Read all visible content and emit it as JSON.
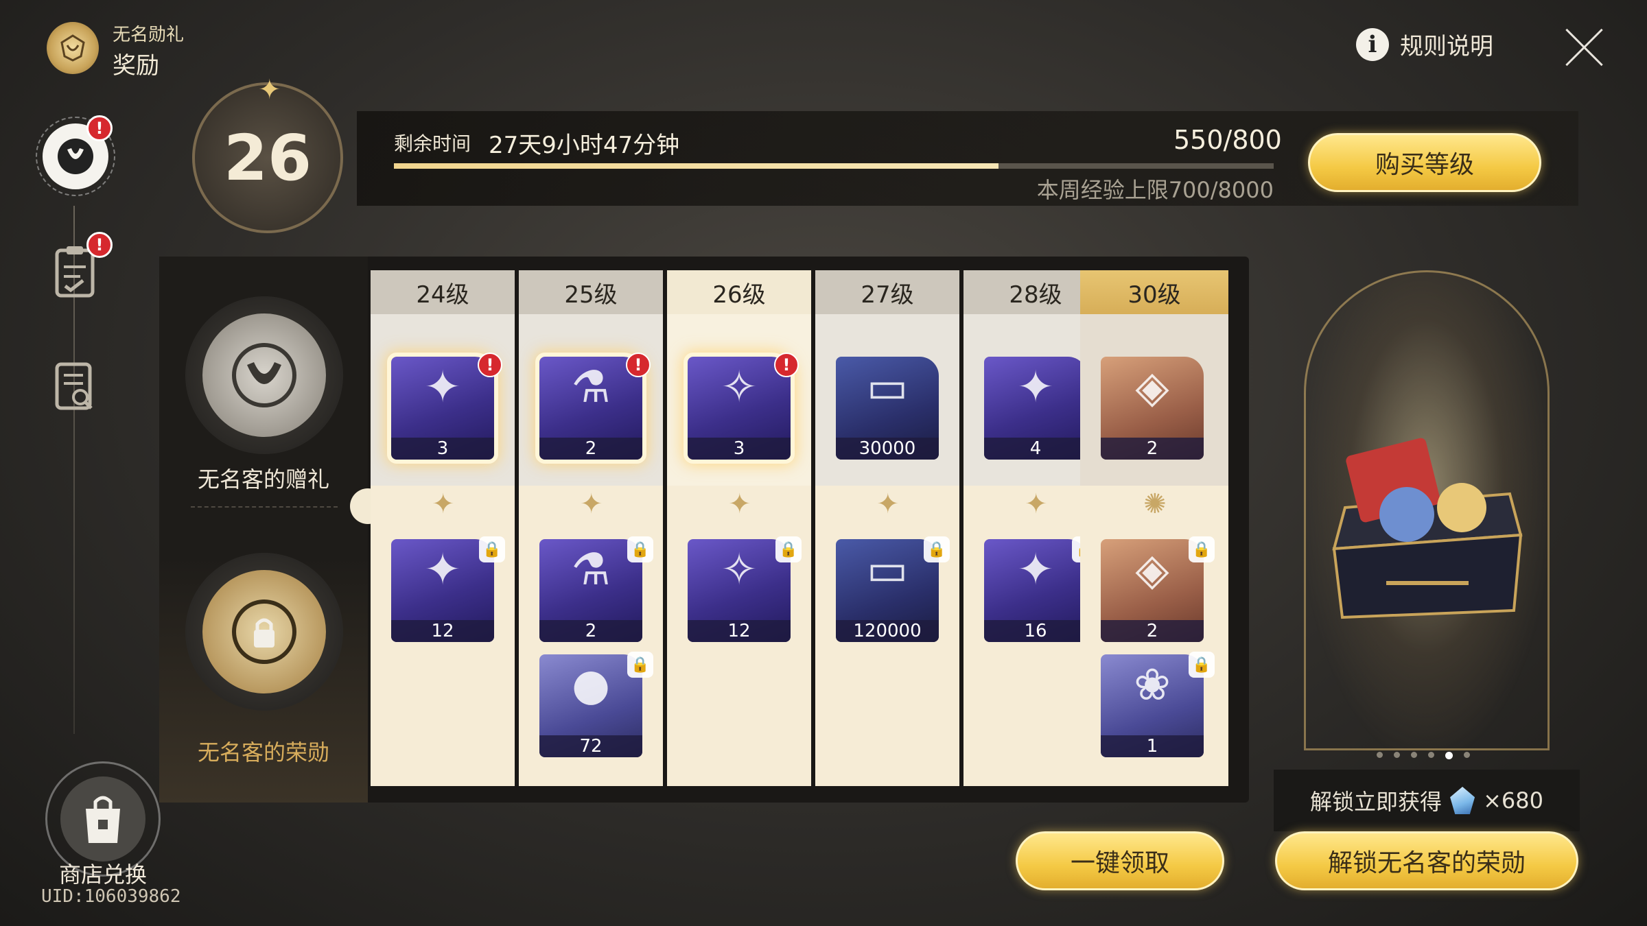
{
  "header": {
    "subtitle": "无名勋礼",
    "title": "奖励",
    "rules_label": "规则说明",
    "rules_icon": "info-icon",
    "close_icon": "close-icon"
  },
  "nav": {
    "alert_glyph": "!",
    "items": [
      {
        "name": "honor-emblem",
        "active": true,
        "alert": true
      },
      {
        "name": "missions-clipboard",
        "active": false,
        "alert": true
      },
      {
        "name": "reward-preview",
        "active": false,
        "alert": false
      }
    ],
    "shop_label": "商店兑换",
    "uid": "UID:106039862"
  },
  "level": {
    "current": "26",
    "time_label": "剩余时间",
    "time_value": "27天9小时47分钟",
    "xp": "550/800",
    "xp_progress": 0.6875,
    "weekly_cap": "本周经验上限700/8000",
    "buy_label": "购买等级"
  },
  "tracks": {
    "free_name": "无名客的赠礼",
    "premium_name": "无名客的荣勋"
  },
  "columns": [
    {
      "level": "24级",
      "free": [
        {
          "qty": "3",
          "icon": "book-icon",
          "style": "",
          "claimable": true
        }
      ],
      "premium": [
        {
          "qty": "12",
          "icon": "book-icon",
          "style": ""
        }
      ]
    },
    {
      "level": "25级",
      "free": [
        {
          "qty": "2",
          "icon": "potion-icon",
          "style": "",
          "claimable": true
        }
      ],
      "premium": [
        {
          "qty": "2",
          "icon": "potion-icon",
          "style": ""
        },
        {
          "qty": "72",
          "icon": "orb-icon",
          "style": "pink"
        }
      ]
    },
    {
      "level": "26级",
      "current": true,
      "free": [
        {
          "qty": "3",
          "icon": "lantern-icon",
          "style": "",
          "claimable": true
        }
      ],
      "premium": [
        {
          "qty": "12",
          "icon": "lantern-icon",
          "style": ""
        }
      ]
    },
    {
      "level": "27级",
      "free": [
        {
          "qty": "30000",
          "icon": "credit-card-icon",
          "style": "dark"
        }
      ],
      "premium": [
        {
          "qty": "120000",
          "icon": "credit-card-icon",
          "style": "dark"
        }
      ]
    },
    {
      "level": "28级",
      "free": [
        {
          "qty": "4",
          "icon": "book-icon",
          "style": ""
        }
      ],
      "premium": [
        {
          "qty": "16",
          "icon": "book-icon",
          "style": ""
        }
      ]
    },
    {
      "level": "30级",
      "last": true,
      "free": [
        {
          "qty": "2",
          "icon": "ticket-icon",
          "style": "warm"
        }
      ],
      "premium": [
        {
          "qty": "2",
          "icon": "ticket-icon",
          "style": "warm"
        },
        {
          "qty": "1",
          "icon": "gift-box-icon",
          "style": "pink"
        }
      ]
    }
  ],
  "chest": {
    "icon": "treasure-chest-icon",
    "carousel_count": 6,
    "carousel_active": 4,
    "unlock_tip": "解锁立即获得",
    "unlock_reward": "×680",
    "unlock_button": "解锁无名客的荣勋",
    "claim_all": "一键领取"
  },
  "colors": {
    "gold": "#f4c944",
    "alert_red": "#d6282e",
    "column_bg": "#f6ecd6"
  }
}
